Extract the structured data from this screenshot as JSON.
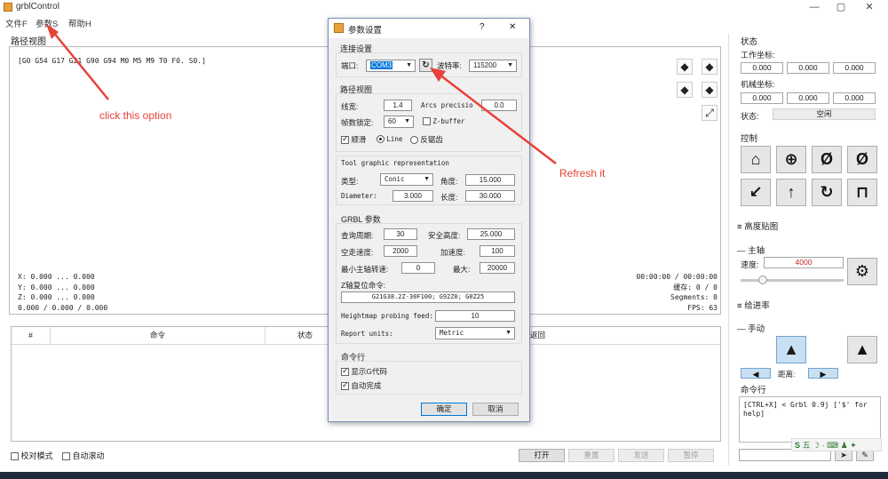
{
  "window": {
    "title": "grblControl"
  },
  "menu": [
    "文件F",
    "参数S",
    "帮助H"
  ],
  "path_view": {
    "label": "路径视图",
    "gcode": "[G0 G54 G17 G21 G90 G94 M0 M5 M9 T0 F0. S0.]",
    "coords": [
      "X: 0.000 ... 0.000",
      "Y: 0.000 ... 0.000",
      "Z: 0.000 ... 0.000",
      "0.000 / 0.000 / 0.000"
    ],
    "times": [
      "00:00:00 / 00:00:00",
      "缓存:    0 / 0",
      "Segments: 0",
      "FPS: 63"
    ]
  },
  "table": {
    "headers": [
      "#",
      "命令",
      "状态",
      "返回"
    ]
  },
  "bottom": {
    "check_mode": "校对模式",
    "autoscroll": "自动滚动",
    "buttons": [
      "打开",
      "重置",
      "发送",
      "暂停"
    ]
  },
  "right": {
    "state_title": "状态",
    "work_coords_label": "工作坐标:",
    "work_coords": [
      "0.000",
      "0.000",
      "0.000"
    ],
    "machine_coords_label": "机械坐标:",
    "machine_coords": [
      "0.000",
      "0.000",
      "0.000"
    ],
    "status_label": "状态:",
    "status_value": "空闲",
    "control_title": "控制",
    "heightmap_title": "高度贴图",
    "spindle_title": "主轴",
    "speed_label": "速度:",
    "speed_value": "4000",
    "feed_title": "给进率",
    "manual_title": "手动",
    "distance_label": "距离:",
    "console_title": "命令行",
    "console_text": "[CTRL+X] < Grbl 0.9j ['$' for help]"
  },
  "dialog": {
    "title": "参数设置",
    "help": "?",
    "close": "✕",
    "conn_group": "连接设置",
    "port_label": "端口:",
    "port_value": "COM3",
    "baud_label": "波特率:",
    "baud_value": "115200",
    "view_group": "路径视图",
    "line_width_label": "线宽:",
    "line_width": "1.4",
    "arc_label": "Arcs precisio",
    "arc_value": "0.0",
    "fps_lock_label": "帧数锁定:",
    "fps_lock": "60",
    "zbuffer": "Z-buffer",
    "smooth": "顺滑",
    "line": "Line",
    "antialias": "反锯齿",
    "tool_group": "Tool graphic representation",
    "type_label": "类型:",
    "type_value": "Conic",
    "angle_label": "角度:",
    "angle_value": "15.000",
    "diameter_label": "Diameter:",
    "diameter_value": "3.000",
    "length_label": "长度:",
    "length_value": "30.000",
    "grbl_group": "GRBL 参数",
    "query_label": "查询周期:",
    "query_value": "30",
    "safe_label": "安全高度:",
    "safe_value": "25.000",
    "rapid_label": "空走速度:",
    "rapid_value": "2000",
    "accel_label": "加速度:",
    "accel_value": "100",
    "min_spindle_label": "最小主轴转速:",
    "min_spindle": "0",
    "max_label": "最大:",
    "max_value": "20000",
    "zreset_label": "Z轴复位命令:",
    "zreset_value": "G21G38.2Z-30F100; G92Z0; G0Z25",
    "heightmap_label": "Heightmap probing feed:",
    "heightmap_value": "10",
    "units_label": "Report units:",
    "units_value": "Metric",
    "cmd_group": "命令行",
    "show_codes": "显示G代码",
    "autocomplete": "自动完成",
    "ok": "确定",
    "cancel": "取消"
  },
  "annotations": {
    "click": "click this option",
    "refresh": "Refresh it"
  },
  "colors": {
    "annotation": "#e8413a",
    "dialog_border": "#7a8fb3",
    "selection": "#0078d7"
  }
}
